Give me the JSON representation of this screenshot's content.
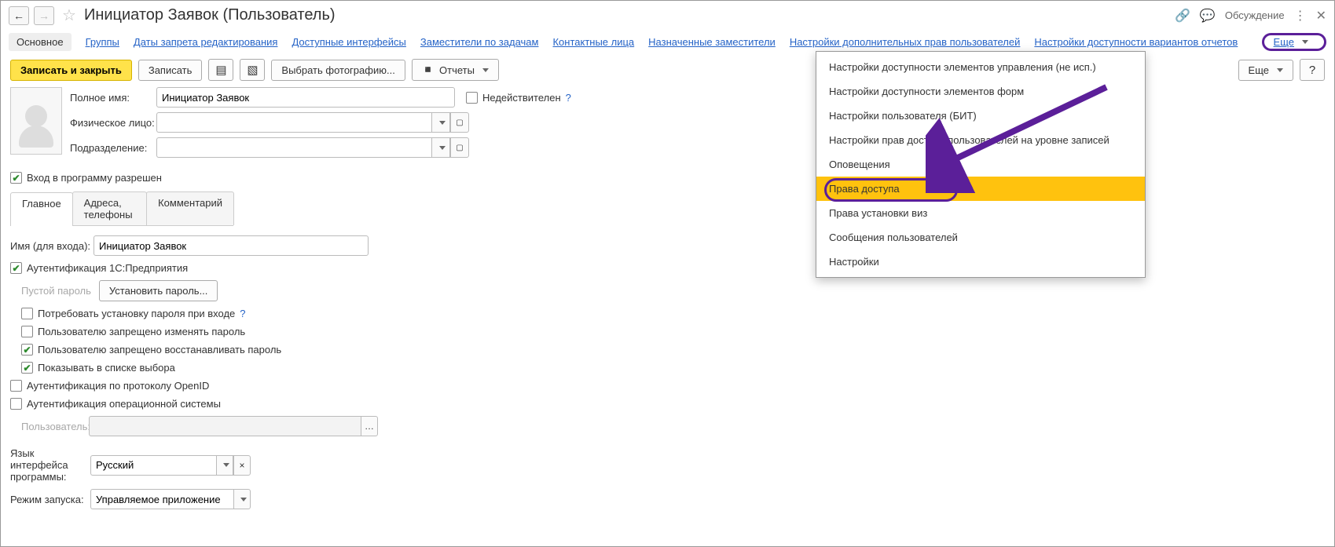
{
  "header": {
    "title": "Инициатор Заявок (Пользователь)",
    "discuss": "Обсуждение"
  },
  "navlinks": {
    "active": "Основное",
    "items": [
      "Группы",
      "Даты запрета редактирования",
      "Доступные интерфейсы",
      "Заместители по задачам",
      "Контактные лица",
      "Назначенные заместители",
      "Настройки дополнительных прав пользователей",
      "Настройки доступности вариантов отчетов"
    ],
    "more": "Еще"
  },
  "toolbar": {
    "save_close": "Записать и закрыть",
    "save": "Записать",
    "photo": "Выбрать фотографию...",
    "reports": "Отчеты",
    "more": "Еще",
    "help": "?"
  },
  "fields": {
    "full_name_label": "Полное имя:",
    "full_name_value": "Инициатор Заявок",
    "invalid_label": "Недействителен",
    "person_label": "Физическое лицо:",
    "dept_label": "Подразделение:"
  },
  "login_allowed": "Вход в программу разрешен",
  "tabs": {
    "main": "Главное",
    "addr": "Адреса, телефоны",
    "comment": "Комментарий"
  },
  "main_tab": {
    "login_label": "Имя (для входа):",
    "login_value": "Инициатор Заявок",
    "auth_1c": "Аутентификация 1С:Предприятия",
    "empty_pwd": "Пустой пароль",
    "set_pwd": "Установить пароль...",
    "require_pwd": "Потребовать установку пароля при входе",
    "deny_change": "Пользователю запрещено изменять пароль",
    "deny_restore": "Пользователю запрещено восстанавливать пароль",
    "show_in_list": "Показывать в списке выбора",
    "auth_openid": "Аутентификация по протоколу OpenID",
    "auth_os": "Аутентификация операционной системы",
    "os_user_label": "Пользователь:",
    "lang_label1": "Язык интерфейса",
    "lang_label2": "программы:",
    "lang_value": "Русский",
    "mode_label": "Режим запуска:",
    "mode_value": "Управляемое приложение"
  },
  "dropdown": {
    "items": [
      "Настройки доступности элементов управления (не исп.)",
      "Настройки доступности элементов форм",
      "Настройки пользователя (БИТ)",
      "Настройки прав доступа пользователей на уровне записей",
      "Оповещения",
      "Права доступа",
      "Права установки виз",
      "Сообщения пользователей",
      "Настройки"
    ]
  }
}
